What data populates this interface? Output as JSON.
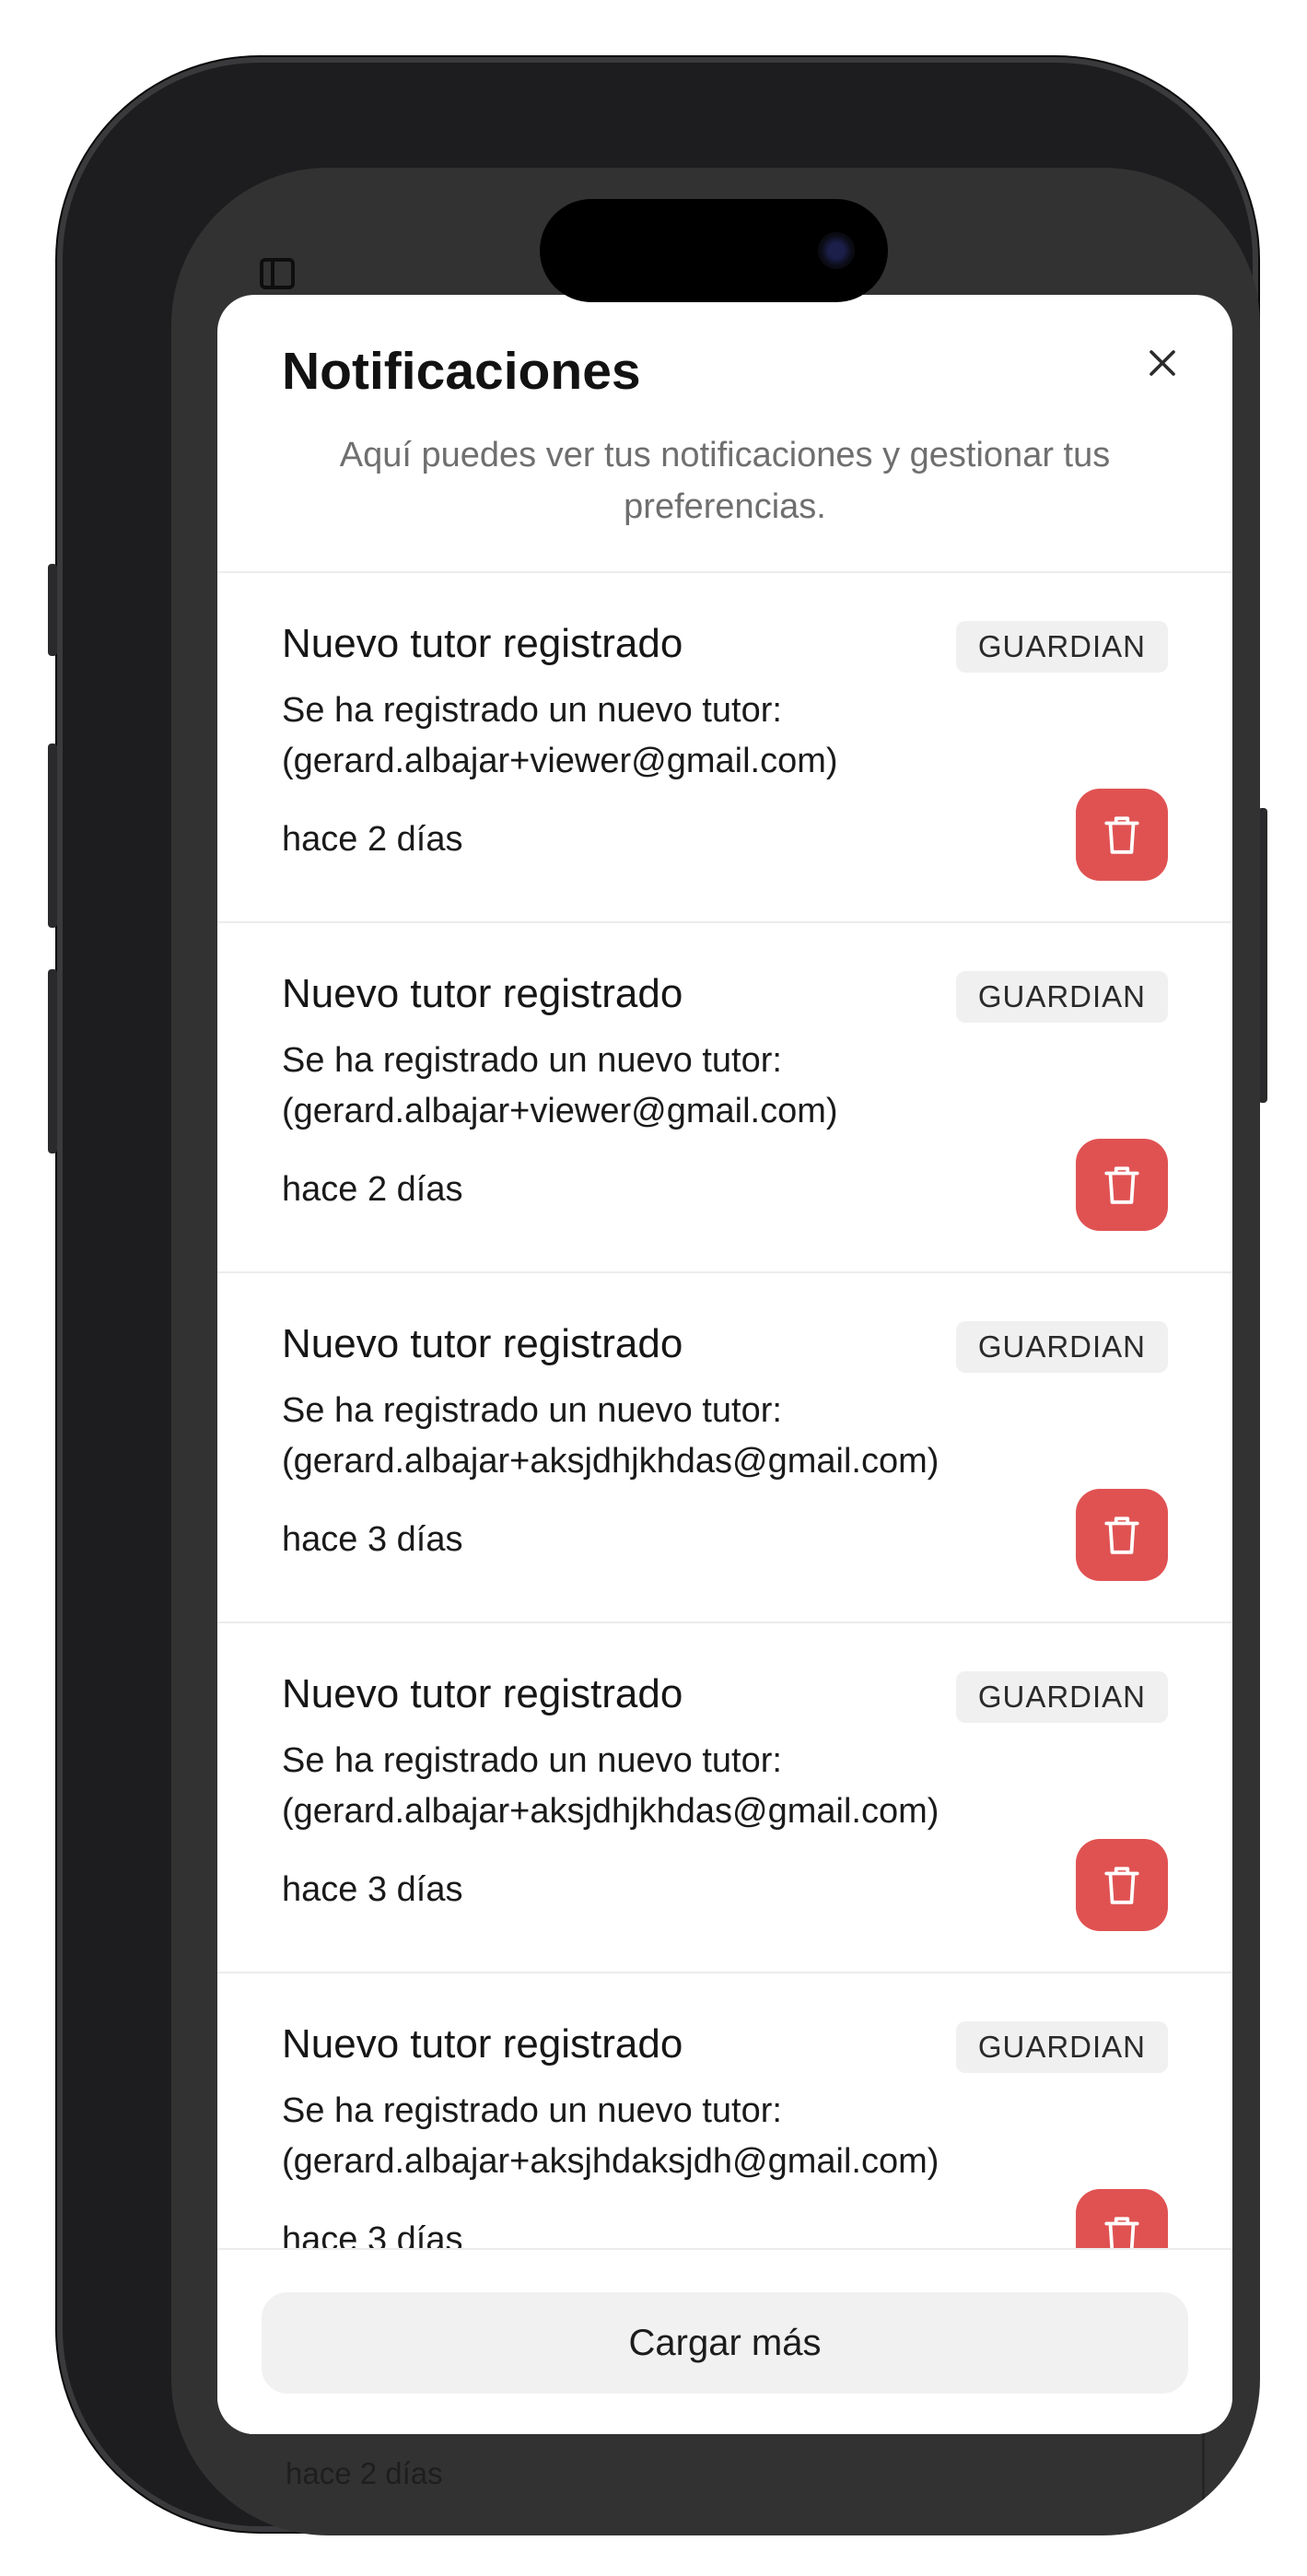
{
  "dialog": {
    "title": "Notificaciones",
    "description": "Aquí puedes ver tus notificaciones y gestionar tus preferencias.",
    "load_more_label": "Cargar más"
  },
  "notifications": [
    {
      "title": "Nuevo tutor registrado",
      "badge": "GUARDIAN",
      "body_line1": "Se ha registrado un nuevo tutor:",
      "body_line2": "(gerard.albajar+viewer@gmail.com)",
      "time": "hace 2 días"
    },
    {
      "title": "Nuevo tutor registrado",
      "badge": "GUARDIAN",
      "body_line1": "Se ha registrado un nuevo tutor:",
      "body_line2": "(gerard.albajar+viewer@gmail.com)",
      "time": "hace 2 días"
    },
    {
      "title": "Nuevo tutor registrado",
      "badge": "GUARDIAN",
      "body_line1": "Se ha registrado un nuevo tutor:",
      "body_line2": "(gerard.albajar+aksjdhjkhdas@gmail.com)",
      "time": "hace 3 días"
    },
    {
      "title": "Nuevo tutor registrado",
      "badge": "GUARDIAN",
      "body_line1": "Se ha registrado un nuevo tutor:",
      "body_line2": "(gerard.albajar+aksjdhjkhdas@gmail.com)",
      "time": "hace 3 días"
    },
    {
      "title": "Nuevo tutor registrado",
      "badge": "GUARDIAN",
      "body_line1": "Se ha registrado un nuevo tutor:",
      "body_line2": "(gerard.albajar+aksjhdaksjdh@gmail.com)",
      "time": "hace 3 días"
    }
  ],
  "background": {
    "time_label": "hace 2 días"
  },
  "icons": {
    "close": "close-icon",
    "delete": "trash-icon",
    "sidebar": "sidebar-toggle-icon"
  },
  "colors": {
    "delete_button": "#e05252",
    "badge_bg": "#f0f0f0",
    "overlay": "#323232"
  }
}
